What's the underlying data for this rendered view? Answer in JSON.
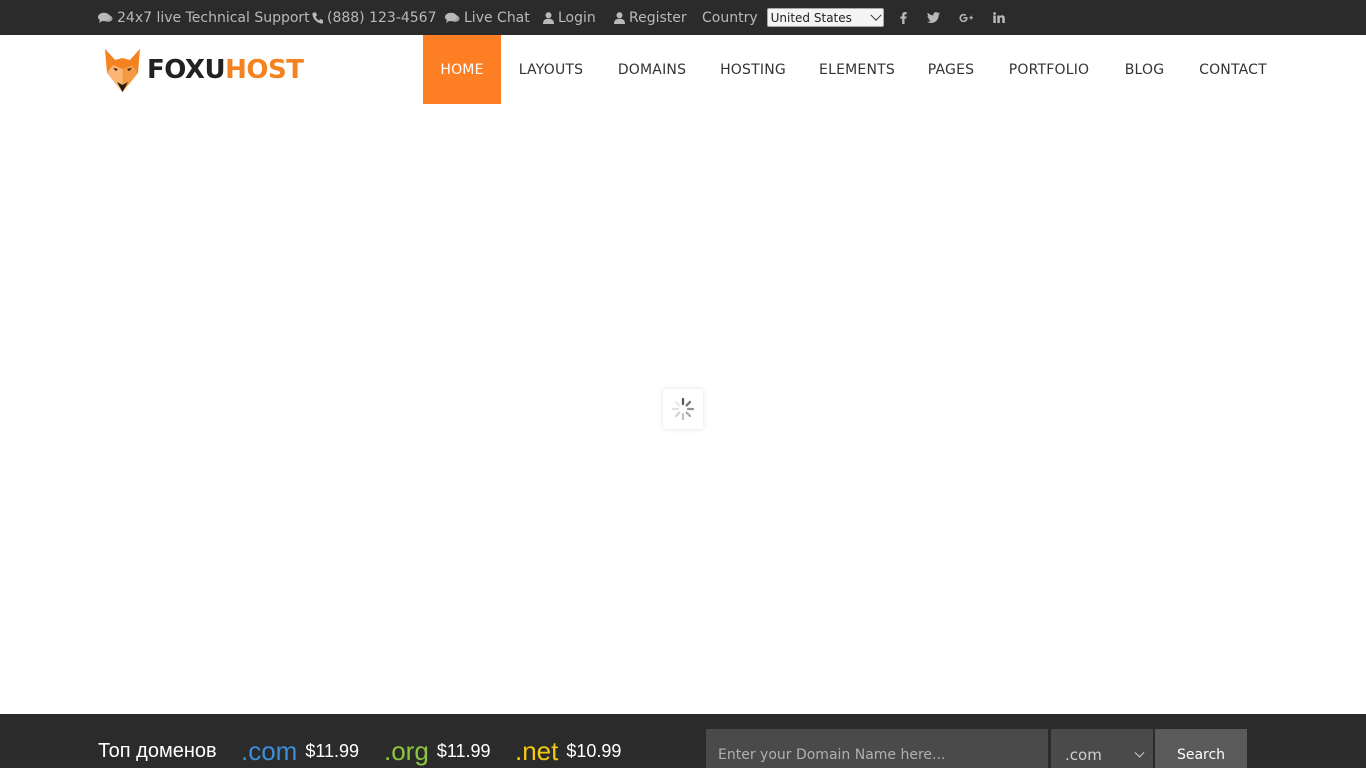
{
  "topbar": {
    "support": "24x7 live Technical Support",
    "phone": "(888) 123-4567",
    "live_chat": "Live Chat",
    "login": "Login",
    "register": "Register",
    "country_label": "Country",
    "country_selected": "United States",
    "social_icons": [
      "facebook-icon",
      "twitter-icon",
      "google-plus-icon",
      "linkedin-icon"
    ]
  },
  "logo": {
    "part1": "FOXU",
    "part2": "HOST"
  },
  "nav": {
    "items": [
      {
        "label": "HOME"
      },
      {
        "label": "LAYOUTS"
      },
      {
        "label": "DOMAINS"
      },
      {
        "label": "HOSTING"
      },
      {
        "label": "ELEMENTS"
      },
      {
        "label": "PAGES"
      },
      {
        "label": "PORTFOLIO"
      },
      {
        "label": "BLOG"
      },
      {
        "label": "CONTACT"
      }
    ],
    "active_label": "HOME"
  },
  "domains": {
    "title": "Топ доменов",
    "list": [
      {
        "ext": ".com",
        "price": "$11.99",
        "color": "#3a8fd8"
      },
      {
        "ext": ".org",
        "price": "$11.99",
        "color": "#8cc63f"
      },
      {
        "ext": ".net",
        "price": "$10.99",
        "color": "#f2c811"
      }
    ],
    "input_placeholder": "Enter your Domain Name here...",
    "select_value": ".com",
    "search_label": "Search"
  },
  "colors": {
    "accent": "#fe7f23",
    "topbar_bg": "#2b2b2b",
    "logo_orange": "#f58220"
  }
}
